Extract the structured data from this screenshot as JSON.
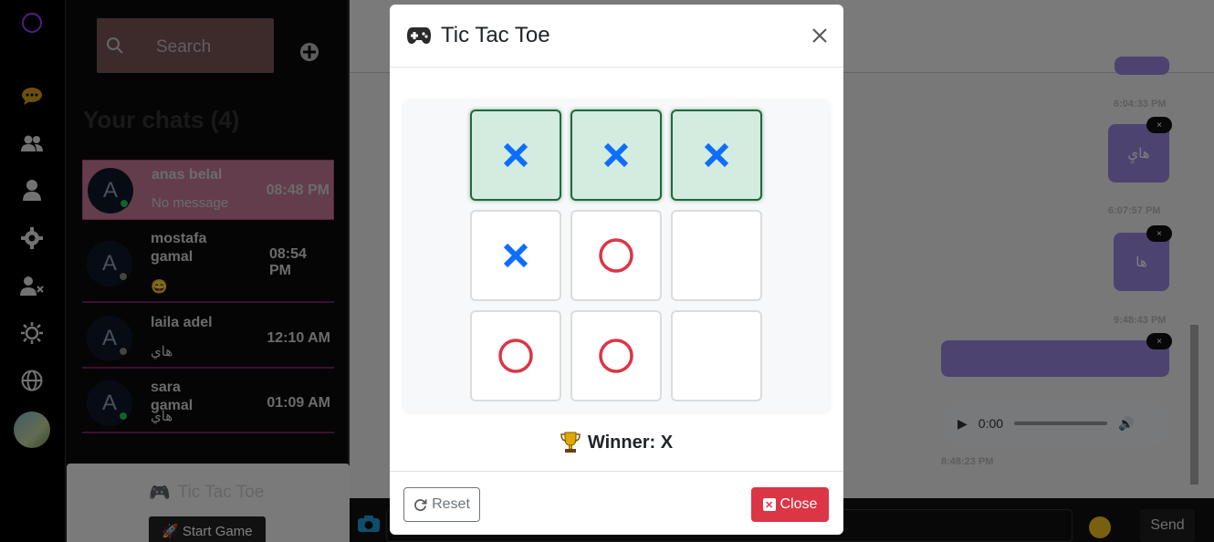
{
  "sidebar": {
    "search_placeholder": "Search",
    "chats_title": "Your chats (4)",
    "chats": [
      {
        "avatar_letter": "A",
        "name": "anas belal",
        "message": "No message",
        "time": "08:48 PM",
        "status_color": "#22c55e"
      },
      {
        "avatar_letter": "A",
        "name": "mostafa gamal",
        "message": "😄",
        "time": "08:54 PM",
        "status_color": "#888888"
      },
      {
        "avatar_letter": "A",
        "name": "laila adel",
        "message": "هاي",
        "time": "12:10 AM",
        "status_color": "#888888"
      },
      {
        "avatar_letter": "A",
        "name": "sara gamal",
        "message": "هاي",
        "time": "01:09 AM",
        "status_color": "#22c55e"
      }
    ],
    "game_panel": {
      "title": "Tic Tac Toe",
      "start_label": "🚀 Start Game"
    }
  },
  "rail": {
    "icons": [
      "chat-icon",
      "group-icon",
      "user-icon",
      "settings-icon",
      "block-user-icon",
      "sun-icon",
      "globe-icon"
    ]
  },
  "chat": {
    "messages": [
      {
        "text": "",
        "timestamp": "6:04:33 PM"
      },
      {
        "text": "هايِ",
        "timestamp": "6:07:57 PM"
      },
      {
        "text": "ها",
        "timestamp": "9:48:43 PM"
      },
      {
        "text": "",
        "timestamp": ""
      }
    ],
    "bubble_close": "×",
    "audio": {
      "time": "0:00",
      "timestamp": "8:48:23 PM"
    },
    "send_label": "Send"
  },
  "modal": {
    "title": "Tic Tac Toe",
    "board": [
      "X",
      "X",
      "X",
      "X",
      "O",
      "",
      "O",
      "O",
      ""
    ],
    "winning_cells": [
      0,
      1,
      2
    ],
    "winner_text": "Winner: X",
    "reset_label": "Reset",
    "close_label": "Close",
    "colors": {
      "x": "#0d6efd",
      "o": "#dc3545",
      "win_bg": "#d4ebdf",
      "win_border": "#1e6a3c",
      "close_btn": "#dc3545"
    }
  }
}
